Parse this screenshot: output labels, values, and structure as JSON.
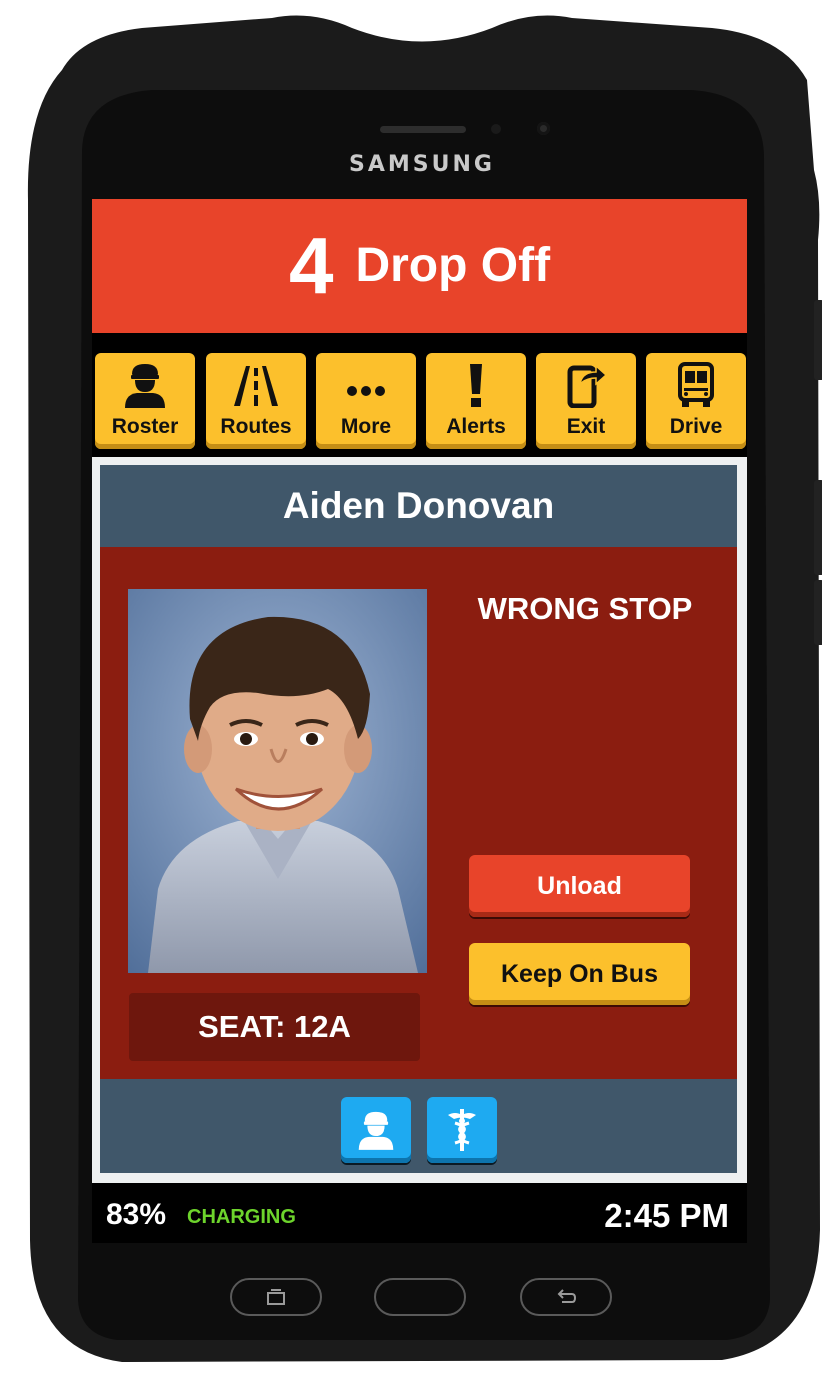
{
  "device": {
    "brand": "SAMSUNG"
  },
  "header": {
    "stop_number": "4",
    "title": "Drop Off"
  },
  "toolbar": {
    "items": [
      {
        "label": "Roster",
        "icon": "driver-icon"
      },
      {
        "label": "Routes",
        "icon": "road-icon"
      },
      {
        "label": "More",
        "icon": "ellipsis-icon"
      },
      {
        "label": "Alerts",
        "icon": "exclamation-icon"
      },
      {
        "label": "Exit",
        "icon": "phone-exit-icon"
      },
      {
        "label": "Drive",
        "icon": "bus-icon"
      }
    ]
  },
  "student": {
    "name": "Aiden Donovan",
    "status": "WRONG STOP",
    "seat": "SEAT: 12A",
    "photo": "student-photo"
  },
  "actions": {
    "unload_label": "Unload",
    "keep_label": "Keep On Bus"
  },
  "bottom_actions": [
    {
      "icon": "driver-icon"
    },
    {
      "icon": "medical-caduceus-icon"
    }
  ],
  "status_bar": {
    "battery": "83%",
    "charging": "CHARGING",
    "time": "2:45 PM"
  },
  "colors": {
    "header_red": "#e8442a",
    "button_yellow": "#fcc02c",
    "panel_red": "#8b1d10",
    "slate": "#40576a",
    "button_blue": "#1eaaf1",
    "charging_green": "#6dd42c"
  }
}
